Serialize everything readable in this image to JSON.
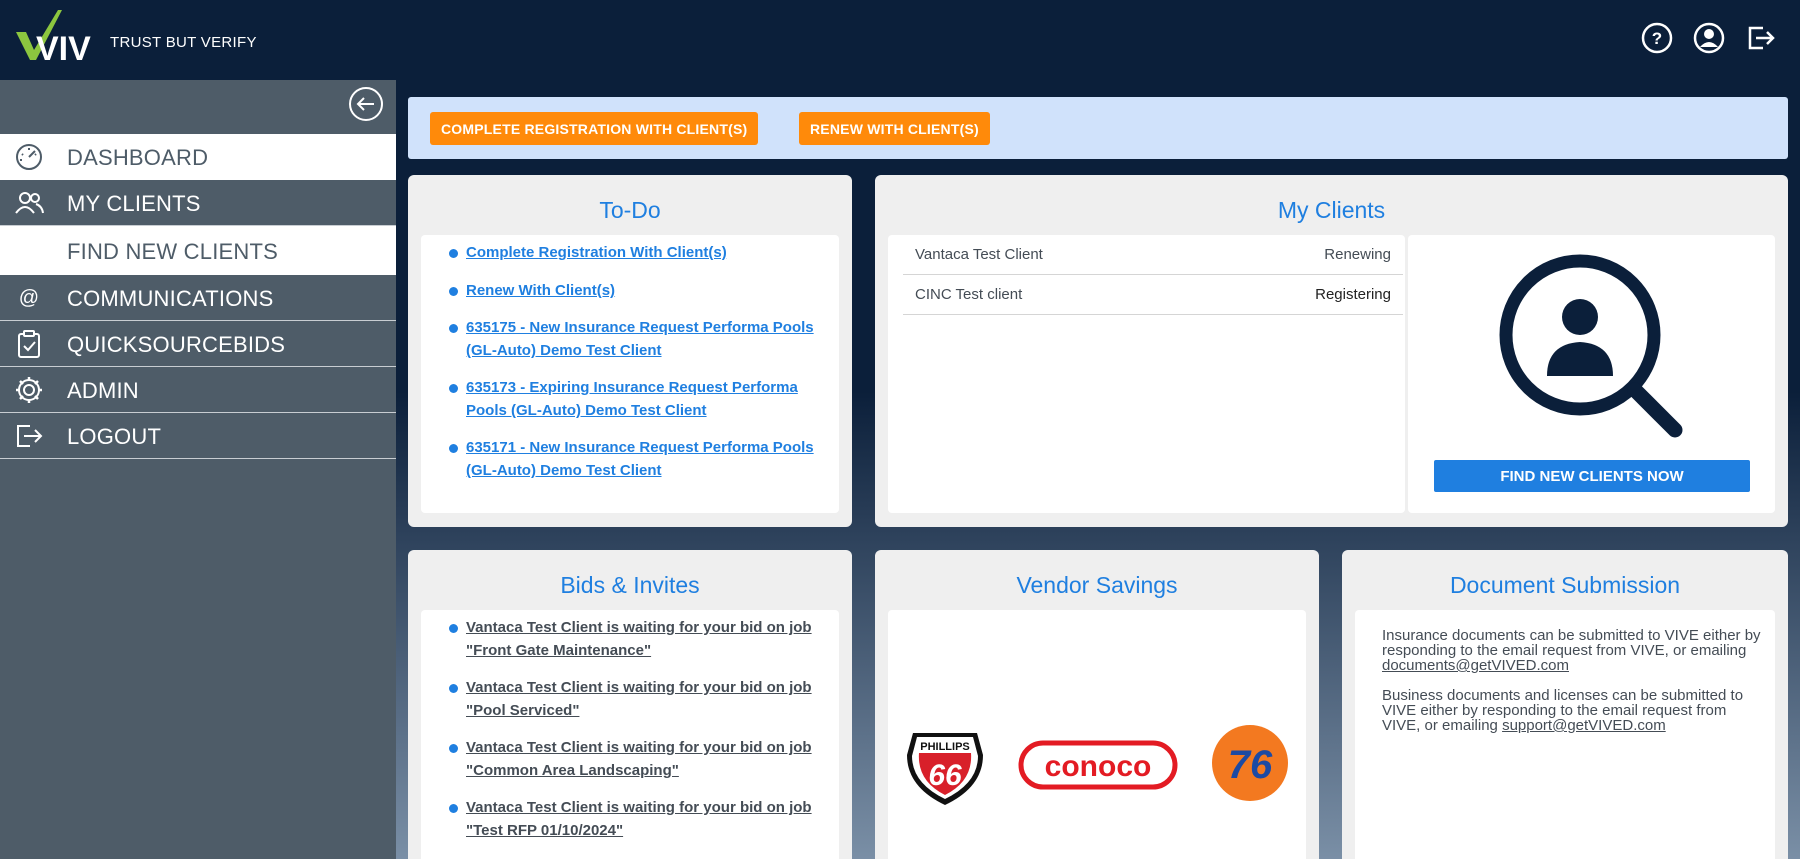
{
  "header": {
    "logo_text": "VIVE",
    "tagline": "TRUST BUT VERIFY"
  },
  "sidebar": {
    "items": [
      {
        "label": "DASHBOARD",
        "icon": "dashboard-gauge-icon",
        "active": true
      },
      {
        "label": "MY CLIENTS",
        "icon": "users-icon",
        "active": false
      },
      {
        "label": "FIND NEW CLIENTS",
        "icon": "",
        "active": true
      },
      {
        "label": "COMMUNICATIONS",
        "icon": "at-sign-icon",
        "active": false
      },
      {
        "label": "QUICKSOURCEBIDS",
        "icon": "clipboard-check-icon",
        "active": false
      },
      {
        "label": "ADMIN",
        "icon": "gear-icon",
        "active": false
      },
      {
        "label": "LOGOUT",
        "icon": "logout-icon",
        "active": false
      }
    ]
  },
  "banner": {
    "complete_label": "COMPLETE REGISTRATION WITH CLIENT(S)",
    "renew_label": "RENEW WITH CLIENT(S)"
  },
  "todo": {
    "title": "To-Do",
    "items": [
      "Complete Registration With Client(s)",
      "Renew With Client(s)",
      "635175 - New Insurance Request Performa Pools (GL-Auto) Demo Test Client",
      "635173 - Expiring Insurance Request Performa Pools (GL-Auto) Demo Test Client",
      "635171 - New Insurance Request Performa Pools (GL-Auto) Demo Test Client"
    ]
  },
  "my_clients": {
    "title": "My Clients",
    "rows": [
      {
        "name": "Vantaca Test Client",
        "status": "Renewing"
      },
      {
        "name": "CINC Test client",
        "status": "Registering"
      }
    ],
    "find_button": "FIND NEW CLIENTS NOW"
  },
  "bids": {
    "title": "Bids & Invites",
    "items": [
      {
        "client": "Vantaca Test Client",
        "text": " is waiting for your bid on job \"Front Gate Maintenance\""
      },
      {
        "client": "Vantaca Test Client",
        "text": " is waiting for your bid on job \"Pool Serviced\""
      },
      {
        "client": "Vantaca Test Client",
        "text": " is waiting for your bid on job \"Common Area Landscaping\""
      },
      {
        "client": "Vantaca Test Client",
        "text": " is waiting for your bid on job \"Test RFP 01/10/2024\""
      }
    ]
  },
  "vendor_savings": {
    "title": "Vendor Savings",
    "logos": {
      "phillips_top": "PHILLIPS",
      "phillips_num": "66",
      "conoco": "conoco",
      "seventy_six": "76"
    }
  },
  "documents": {
    "title": "Document Submission",
    "p1": "Insurance documents can be submitted to VIVE either by responding to the email request from VIVE, or emailing ",
    "p1_link": "documents@getVIVED.com",
    "p2": "Business documents and licenses can be submitted to VIVE either by responding to the email request from VIVE, or emailing ",
    "p2_link": "support@getVIVED.com"
  },
  "colors": {
    "navy": "#0b1f3a",
    "sidebar": "#4e5c68",
    "accent_blue": "#1f7fe0",
    "orange": "#ff8a0a"
  }
}
